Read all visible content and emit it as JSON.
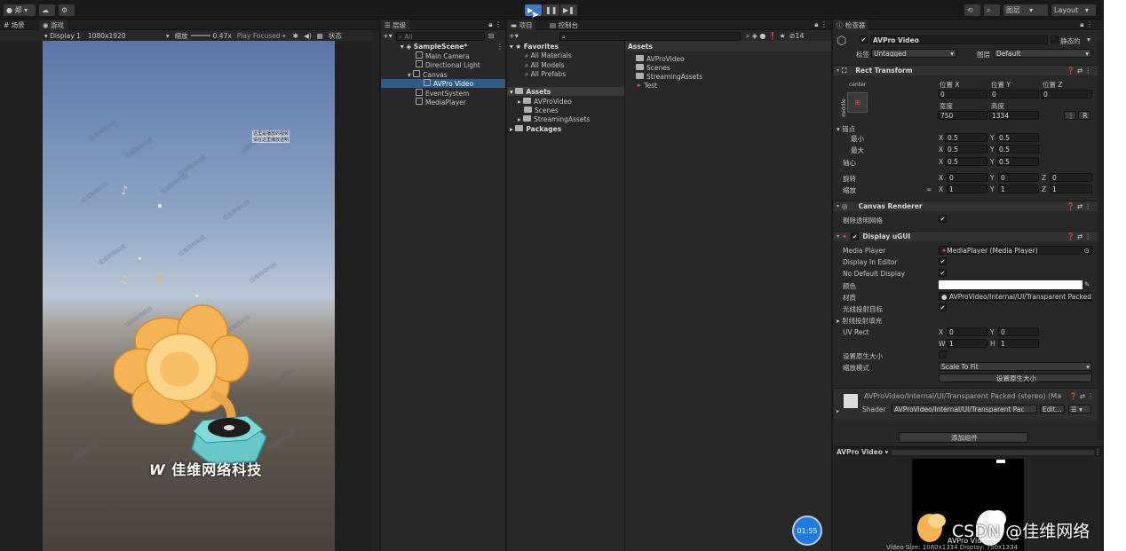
{
  "toolbar": {
    "account": "郑",
    "play_icon": "play-icon",
    "pause_icon": "pause-icon",
    "step_icon": "step-icon",
    "layers": "图层",
    "layout": "Layout"
  },
  "scene_tab": "场景",
  "game_tab": "游戏",
  "game_bar": {
    "display": "Display 1",
    "resolution": "1080x1920",
    "scale_label": "缩放",
    "scale_value": "0.47x",
    "play_mode": "Play Focused",
    "stats": "状态"
  },
  "overlay_text_1": "这里是播放的视频",
  "overlay_text_2": "请在这里播放透明",
  "brand_logo": "佳维网络科技",
  "hierarchy": {
    "tab": "层级",
    "search_placeholder": "All",
    "items": [
      "SampleScene*",
      "Main Camera",
      "Directional Light",
      "Canvas",
      "AVPro Video",
      "EventSystem",
      "MediaPlayer"
    ]
  },
  "project": {
    "tab": "项目",
    "console_tab": "控制台",
    "favorites": "Favorites",
    "fav_items": [
      "All Materials",
      "All Models",
      "All Prefabs"
    ],
    "assets": "Assets",
    "asset_items": [
      "AVProVideo",
      "Scenes",
      "StreamingAssets"
    ],
    "packages": "Packages",
    "breadcrumb": "Assets",
    "list": [
      "AVProVideo",
      "Scenes",
      "StreamingAssets",
      "Test"
    ],
    "count": "14"
  },
  "inspector": {
    "tab": "检查器",
    "object_name": "AVPro Video",
    "static_label": "静态的",
    "tag_label": "标签",
    "tag_value": "Untagged",
    "layer_label": "图层",
    "layer_value": "Default",
    "rect": {
      "title": "Rect Transform",
      "anchor_top": "center",
      "anchor_side": "middle",
      "pos_x": "位置 X",
      "pos_y": "位置 Y",
      "pos_z": "位置 Z",
      "pos_x_val": "0",
      "pos_y_val": "0",
      "pos_z_val": "0",
      "width_label": "宽度",
      "height_label": "高度",
      "width": "750",
      "height": "1334",
      "anchors": "锚点",
      "min": "最小",
      "max": "最大",
      "pivot": "轴心",
      "min_x": "0.5",
      "min_y": "0.5",
      "max_x": "0.5",
      "max_y": "0.5",
      "pivot_x": "0.5",
      "pivot_y": "0.5",
      "rotation": "旋转",
      "rot_x": "0",
      "rot_y": "0",
      "rot_z": "0",
      "scale": "缩放",
      "sc_x": "1",
      "sc_y": "1",
      "sc_z": "1",
      "r_btn": "R"
    },
    "canvas_renderer": {
      "title": "Canvas Renderer",
      "cull": "剔除透明网格"
    },
    "display": {
      "title": "Display uGUI",
      "media_player": "Media Player",
      "media_player_value": "MediaPlayer (Media Player)",
      "display_in_editor": "Display In Editor",
      "no_default": "No Default Display",
      "color": "颜色",
      "material": "材质",
      "material_value": "AVProVideo/Internal/UI/Transparent Packed",
      "raycast": "光线投射目标",
      "raycast_padding": "射线投射填充",
      "uv_rect": "UV Rect",
      "uv_x": "0",
      "uv_y": "0",
      "uv_w": "1",
      "uv_h": "1",
      "native_size_toggle": "设置原生大小",
      "scale_mode": "缩放模式",
      "scale_mode_value": "Scale To Fit",
      "native_size_btn": "设置原生大小"
    },
    "material_block": {
      "title": "AVProVideo/Internal/UI/Transparent Packed (stereo) (Ma",
      "shader_label": "Shader",
      "shader_value": "AVProVideo/Internal/UI/Transparent Pac",
      "edit": "Edit..."
    },
    "add_component": "添加组件",
    "preview_title": "AVPro Video",
    "preview_caption": "AVPro Video",
    "video_size": "Video Size: 1080x1334   Display: 750x1334"
  },
  "timer": "01:55",
  "watermark": "CSDN @佳维网络"
}
